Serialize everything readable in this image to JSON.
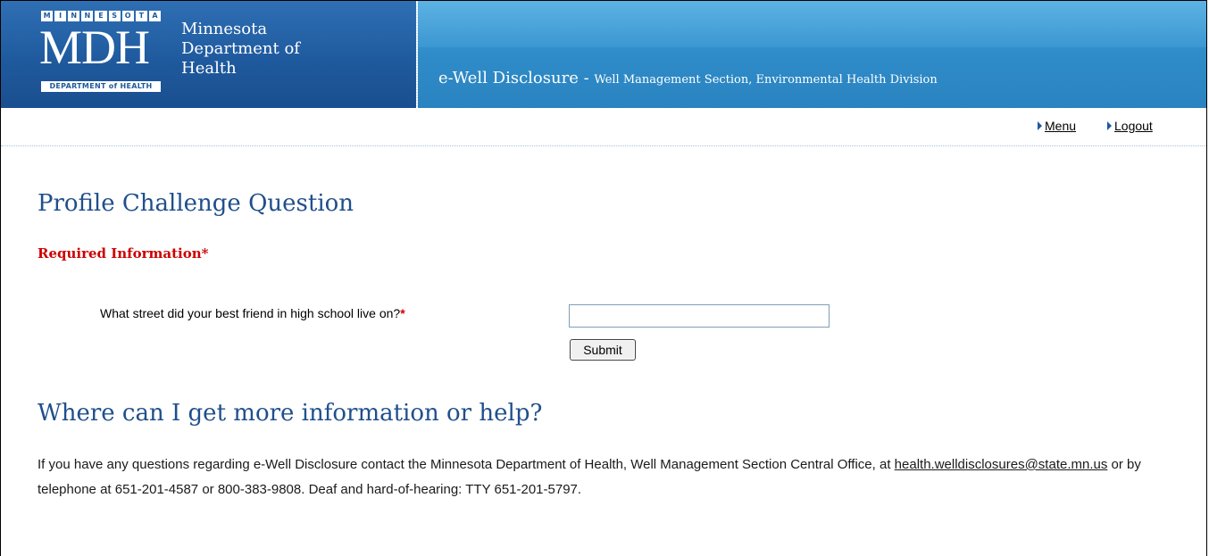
{
  "header": {
    "logo": {
      "top_letters": [
        "M",
        "I",
        "N",
        "N",
        "E",
        "S",
        "O",
        "T",
        "A"
      ],
      "mark": "MDH",
      "bottom": "DEPARTMENT of HEALTH"
    },
    "dept_line1": "Minnesota",
    "dept_line2": "Department of",
    "dept_line3": "Health",
    "app_name": "e-Well Disclosure",
    "app_separator": " - ",
    "app_subtitle": "Well Management Section, Environmental Health Division"
  },
  "nav": {
    "menu_label": "Menu",
    "logout_label": "Logout"
  },
  "form": {
    "title": "Profile Challenge Question",
    "required_label": "Required Information",
    "required_marker": "*",
    "question_label": "What street did your best friend in high school live on?",
    "answer_value": "",
    "submit_label": "Submit"
  },
  "help": {
    "title": "Where can I get more information or help?",
    "text_before": "If you have any questions regarding e-Well Disclosure contact the Minnesota Department of Health, Well Management Section Central Office, at ",
    "email": "health.welldisclosures@state.mn.us",
    "text_after": " or by telephone at 651-201-4587 or 800-383-9808. Deaf and hard-of-hearing: TTY 651-201-5797."
  },
  "colors": {
    "brand_blue": "#1f5a9e",
    "banner_blue": "#2f8cc8",
    "heading_blue": "#1f4f8c",
    "required_red": "#cc0000"
  }
}
